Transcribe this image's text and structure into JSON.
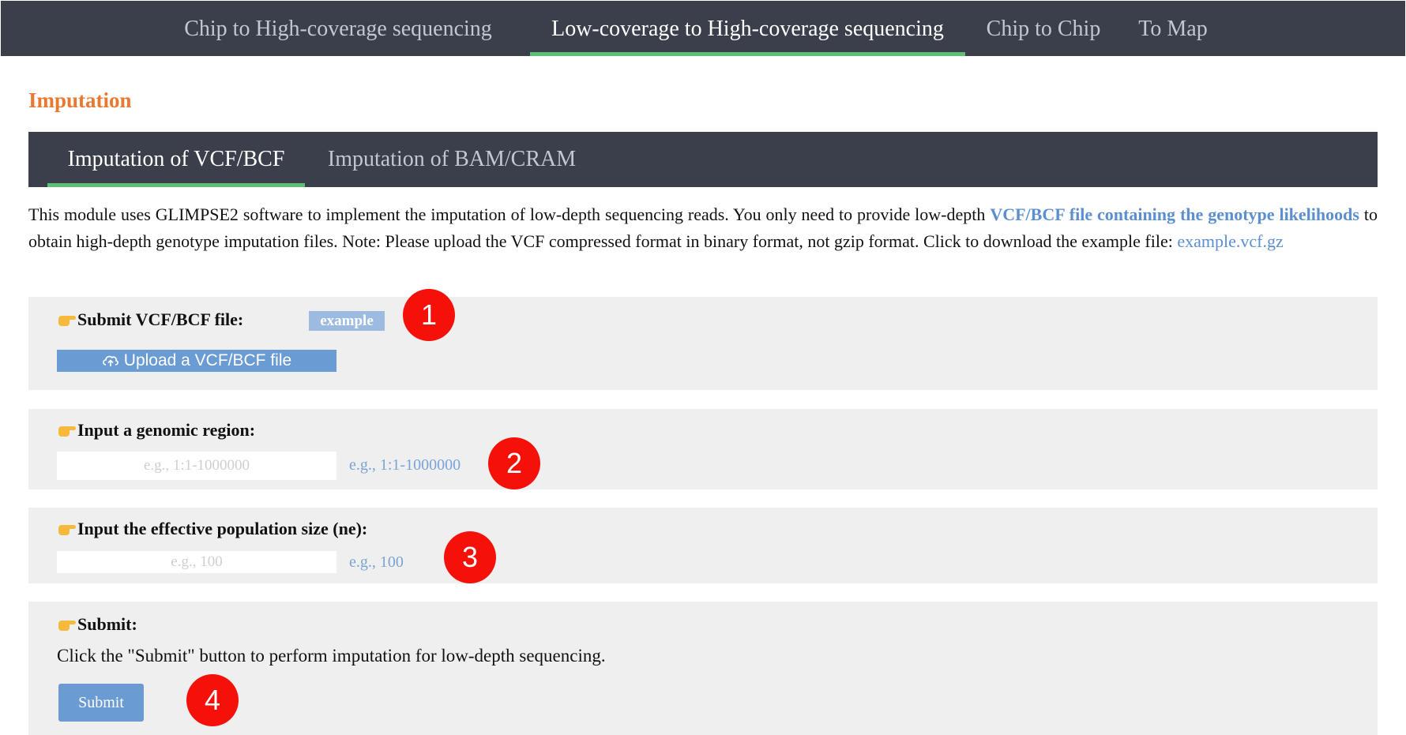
{
  "topnav": {
    "items": [
      {
        "label": "Chip to High-coverage sequencing",
        "active": false
      },
      {
        "label": "Low-coverage to High-coverage sequencing",
        "active": true
      },
      {
        "label": "Chip to Chip",
        "active": false
      },
      {
        "label": "To Map",
        "active": false
      }
    ]
  },
  "section_title": "Imputation",
  "subtabs": {
    "items": [
      {
        "label": "Imputation of VCF/BCF",
        "active": true
      },
      {
        "label": "Imputation of BAM/CRAM",
        "active": false
      }
    ]
  },
  "description": {
    "text_before": "This module uses GLIMPSE2 software to implement the imputation of low-depth sequencing reads. You only need to provide low-depth ",
    "link_genotype": "VCF/BCF file containing the genotype likelihoods",
    "text_after": " to obtain high-depth genotype imputation files. Note: Please upload the VCF compressed format in binary format, not gzip format. Click to download the example file: ",
    "link_example_file": "example.vcf.gz"
  },
  "step1": {
    "label": "Submit VCF/BCF file:",
    "example_badge": "example",
    "upload_label": "Upload a VCF/BCF file",
    "marker": "1"
  },
  "step2": {
    "label": "Input a genomic region:",
    "input_value": "",
    "placeholder": "e.g., 1:1-1000000",
    "hint": "e.g., 1:1-1000000",
    "marker": "2"
  },
  "step3": {
    "label": "Input the effective population size (ne):",
    "input_value": "",
    "placeholder": "e.g., 100",
    "hint": "e.g., 100",
    "marker": "3"
  },
  "step4": {
    "label": "Submit:",
    "instruction": "Click the \"Submit\" button to perform imputation for low-depth sequencing.",
    "button_label": "Submit",
    "marker": "4"
  },
  "icons": {
    "pointing_hand": "pointing-hand-icon",
    "upload": "cloud-upload-icon"
  },
  "colors": {
    "nav_bg": "#3a3f4b",
    "active_underline": "#5bbf74",
    "section_title": "#e8792f",
    "link": "#5b8fd0",
    "button": "#6b9bd3",
    "panel_bg": "#efefef",
    "marker": "#f5100a"
  }
}
